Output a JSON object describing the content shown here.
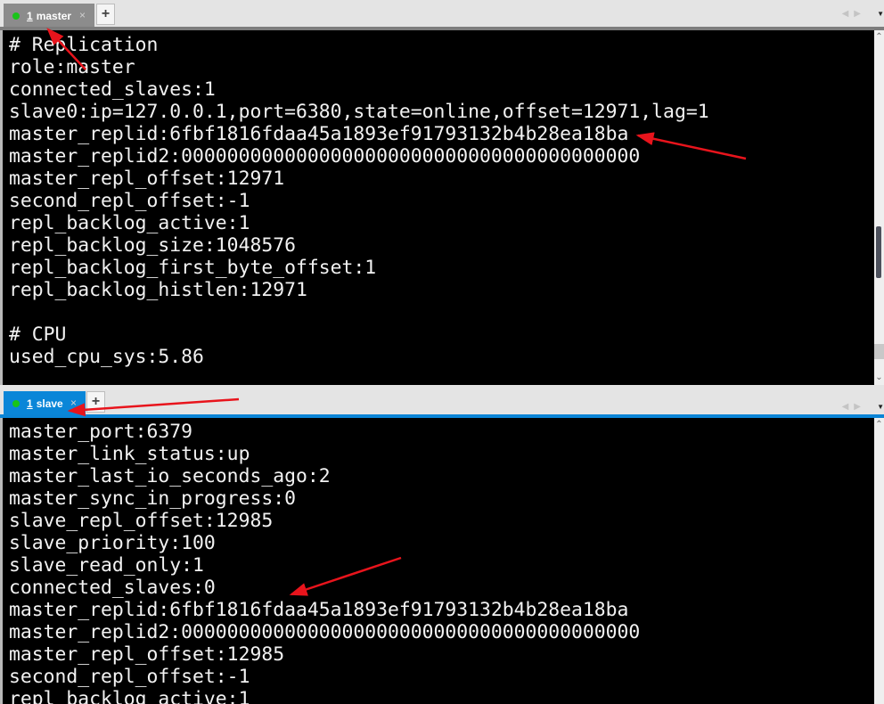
{
  "panes": {
    "master": {
      "tab": {
        "number": "1",
        "label": "master",
        "status_color": "#19c419",
        "active": false
      },
      "new_tab_label": "+",
      "close_label": "×",
      "lines": [
        "# Replication",
        "role:master",
        "connected_slaves:1",
        "slave0:ip=127.0.0.1,port=6380,state=online,offset=12971,lag=1",
        "master_replid:6fbf1816fdaa45a1893ef91793132b4b28ea18ba",
        "master_replid2:0000000000000000000000000000000000000000",
        "master_repl_offset:12971",
        "second_repl_offset:-1",
        "repl_backlog_active:1",
        "repl_backlog_size:1048576",
        "repl_backlog_first_byte_offset:1",
        "repl_backlog_histlen:12971",
        "",
        "# CPU",
        "used_cpu_sys:5.86"
      ]
    },
    "slave": {
      "tab": {
        "number": "1",
        "label": "slave",
        "status_color": "#19c419",
        "active": true
      },
      "new_tab_label": "+",
      "close_label": "×",
      "lines": [
        "master_port:6379",
        "master_link_status:up",
        "master_last_io_seconds_ago:2",
        "master_sync_in_progress:0",
        "slave_repl_offset:12985",
        "slave_priority:100",
        "slave_read_only:1",
        "connected_slaves:0",
        "master_replid:6fbf1816fdaa45a1893ef91793132b4b28ea18ba",
        "master_replid2:0000000000000000000000000000000000000000",
        "master_repl_offset:12985",
        "second_repl_offset:-1",
        "repl_backlog_active:1"
      ]
    }
  },
  "icons": {
    "nav_prev": "◀",
    "nav_next": "▶",
    "tab_menu": "▼",
    "scroll_up": "⌃",
    "scroll_down": "⌄"
  },
  "annotation_color": "#e8141c"
}
